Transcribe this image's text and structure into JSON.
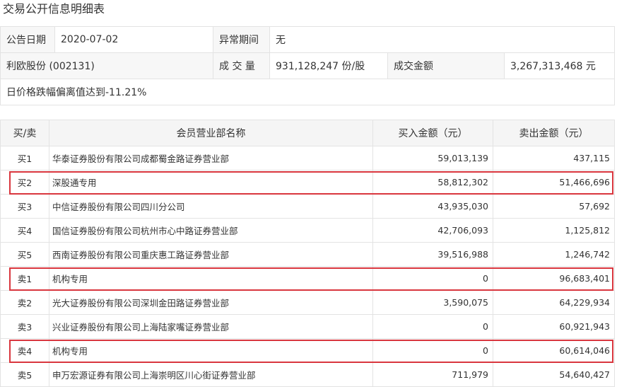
{
  "page": {
    "title": "交易公开信息明细表"
  },
  "info": {
    "date_label": "公告日期",
    "date_value": "2020-07-02",
    "abnormal_label": "异常期间",
    "abnormal_value": "无",
    "stock": "利欧股份 (002131)",
    "volume_label": "成 交 量",
    "volume_value": "931,128,247 份/股",
    "amount_label": "成交金额",
    "amount_value": "3,267,313,468 元",
    "reason": "日价格跌幅偏离值达到-11.21%"
  },
  "table": {
    "headers": [
      "买/卖",
      "会员营业部名称",
      "买入金额（元）",
      "卖出金额（元）"
    ],
    "rows": [
      {
        "side": "买1",
        "name": "华泰证券股份有限公司成都蜀金路证券营业部",
        "buy": "59,013,139",
        "sell": "437,115",
        "highlight": false
      },
      {
        "side": "买2",
        "name": "深股通专用",
        "buy": "58,812,302",
        "sell": "51,466,696",
        "highlight": true
      },
      {
        "side": "买3",
        "name": "中信证券股份有限公司四川分公司",
        "buy": "43,935,030",
        "sell": "57,692",
        "highlight": false
      },
      {
        "side": "买4",
        "name": "国信证券股份有限公司杭州市心中路证券营业部",
        "buy": "42,706,093",
        "sell": "1,125,812",
        "highlight": false
      },
      {
        "side": "买5",
        "name": "西南证券股份有限公司重庆惠工路证券营业部",
        "buy": "39,516,988",
        "sell": "1,246,742",
        "highlight": false
      },
      {
        "side": "卖1",
        "name": "机构专用",
        "buy": "0",
        "sell": "96,683,401",
        "highlight": true
      },
      {
        "side": "卖2",
        "name": "光大证券股份有限公司深圳金田路证券营业部",
        "buy": "3,590,075",
        "sell": "64,229,934",
        "highlight": false
      },
      {
        "side": "卖3",
        "name": "兴业证券股份有限公司上海陆家嘴证券营业部",
        "buy": "0",
        "sell": "60,921,943",
        "highlight": false
      },
      {
        "side": "卖4",
        "name": "机构专用",
        "buy": "0",
        "sell": "60,614,046",
        "highlight": true
      },
      {
        "side": "卖5",
        "name": "申万宏源证券有限公司上海崇明区川心街证券营业部",
        "buy": "711,979",
        "sell": "54,640,427",
        "highlight": false
      }
    ]
  },
  "colors": {
    "highlight_border": "#d9363e",
    "header_bg": "#f5f5f5",
    "grid": "#e3e3e3"
  }
}
